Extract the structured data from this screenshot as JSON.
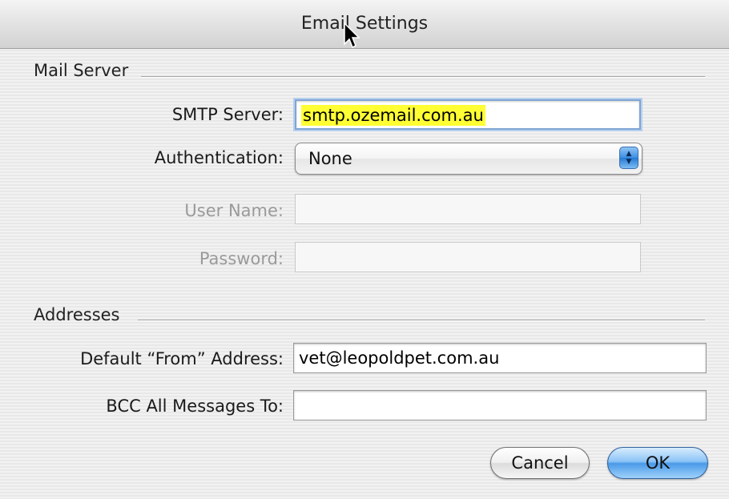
{
  "window": {
    "title": "Email Settings"
  },
  "mail_server": {
    "section_label": "Mail Server",
    "smtp_label": "SMTP Server:",
    "smtp_value": "smtp.ozemail.com.au",
    "auth_label": "Authentication:",
    "auth_value": "None",
    "username_label": "User Name:",
    "username_value": "",
    "password_label": "Password:",
    "password_value": ""
  },
  "addresses": {
    "section_label": "Addresses",
    "from_label": "Default “From” Address:",
    "from_value": "vet@leopoldpet.com.au",
    "bcc_label": "BCC All Messages To:",
    "bcc_value": ""
  },
  "buttons": {
    "cancel_label": "Cancel",
    "ok_label": "OK"
  },
  "colors": {
    "selection_highlight": "#ffff33",
    "default_button": "#4a9ae8",
    "focus_ring": "#7fa6d6"
  },
  "icons": {
    "popup_arrows": "up-down-arrows-icon",
    "cursor": "mouse-pointer-icon"
  }
}
